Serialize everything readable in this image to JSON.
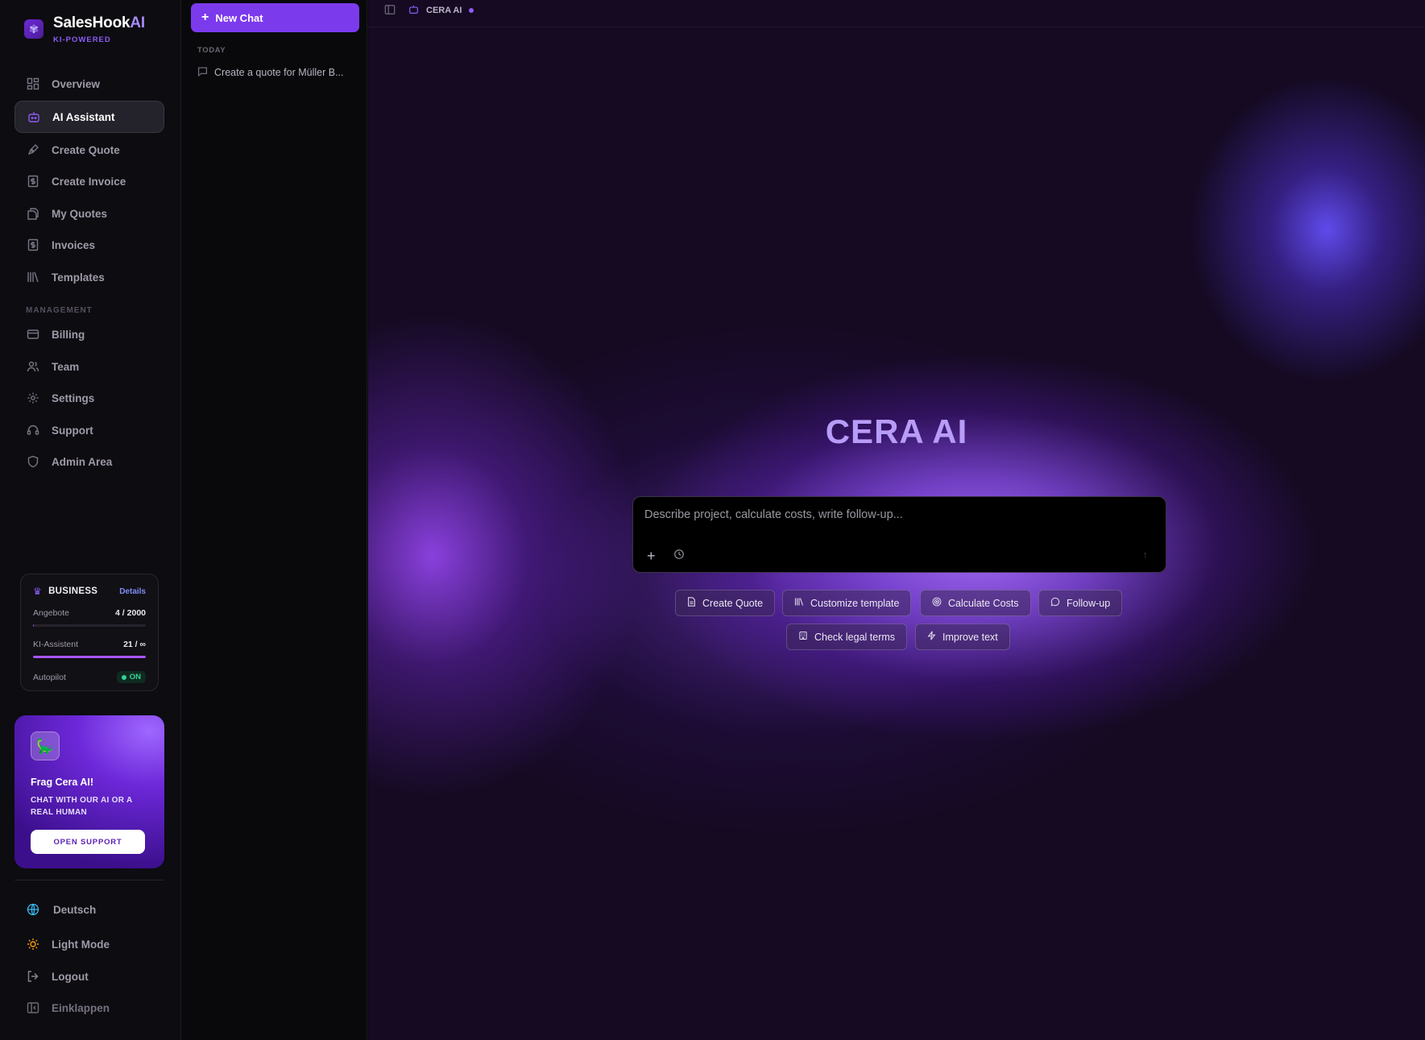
{
  "brand": {
    "name": "SalesHook",
    "name_suffix": "AI",
    "tagline": "KI-POWERED"
  },
  "nav": {
    "items": [
      {
        "label": "Overview",
        "icon": "grid-icon"
      },
      {
        "label": "AI Assistant",
        "icon": "robot-icon",
        "active": true
      },
      {
        "label": "Create Quote",
        "icon": "pen-icon"
      },
      {
        "label": "Create Invoice",
        "icon": "dollar-doc-icon"
      },
      {
        "label": "My Quotes",
        "icon": "files-icon"
      },
      {
        "label": "Invoices",
        "icon": "dollar-doc-icon"
      },
      {
        "label": "Templates",
        "icon": "library-icon"
      }
    ],
    "management_label": "MANAGEMENT",
    "management_items": [
      {
        "label": "Billing",
        "icon": "card-icon"
      },
      {
        "label": "Team",
        "icon": "users-icon"
      },
      {
        "label": "Settings",
        "icon": "gear-icon"
      },
      {
        "label": "Support",
        "icon": "headset-icon"
      },
      {
        "label": "Admin Area",
        "icon": "shield-icon"
      }
    ]
  },
  "plan": {
    "name": "BUSINESS",
    "details_label": "Details",
    "quotes_label": "Angebote",
    "quotes_value": "4 / 2000",
    "quotes_fraction": 0.002,
    "assistant_label": "KI-Assistent",
    "assistant_value": "21 / ∞",
    "assistant_fraction": 1.0,
    "autopilot_label": "Autopilot",
    "autopilot_status": "ON"
  },
  "promo": {
    "title": "Frag Cera AI!",
    "subtitle": "CHAT WITH OUR AI OR A REAL HUMAN",
    "button": "OPEN SUPPORT"
  },
  "bottom": {
    "language": "Deutsch",
    "theme": "Light Mode",
    "logout": "Logout",
    "collapse": "Einklappen"
  },
  "chatlist": {
    "new_chat": "New Chat",
    "group_today": "TODAY",
    "chats": [
      "Create a quote for Müller B..."
    ]
  },
  "topbar": {
    "title": "CERA AI"
  },
  "main": {
    "hero_title": "CERA AI",
    "input_placeholder": "Describe project, calculate costs, write follow-up...",
    "suggestions_row1": [
      {
        "label": "Create Quote",
        "icon": "document-icon"
      },
      {
        "label": "Customize template",
        "icon": "library-icon"
      },
      {
        "label": "Calculate Costs",
        "icon": "target-icon"
      },
      {
        "label": "Follow-up",
        "icon": "chat-bubble-icon"
      }
    ],
    "suggestions_row2": [
      {
        "label": "Check legal terms",
        "icon": "bank-icon"
      },
      {
        "label": "Improve text",
        "icon": "lightning-icon"
      }
    ]
  },
  "colors": {
    "accent": "#7c3aed",
    "hero": "#b79cf8",
    "status_on": "#34d399"
  }
}
